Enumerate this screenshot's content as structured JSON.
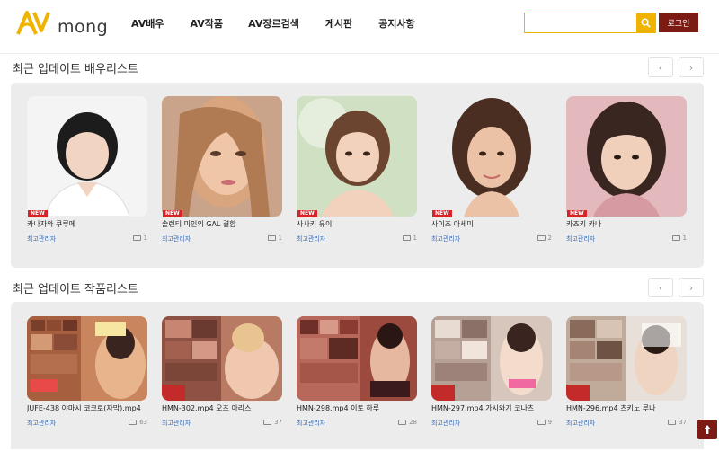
{
  "header": {
    "logo_text": "mong",
    "nav": [
      "AV배우",
      "AV작품",
      "AV장르검색",
      "게시판",
      "공지사항"
    ],
    "search": {
      "value": "",
      "placeholder": ""
    },
    "login_label": "로그인"
  },
  "actors_section": {
    "title": "최근 업데이트 배우리스트",
    "prev": "‹",
    "next": "›",
    "items": [
      {
        "title": "카나자와 쿠루메",
        "author": "최고관리자",
        "count": "1",
        "badge": "NEW"
      },
      {
        "title": "솔렌티 미인의 GAL 결함",
        "author": "최고관리자",
        "count": "1",
        "badge": "NEW"
      },
      {
        "title": "사사키 유이",
        "author": "최고관리자",
        "count": "1",
        "badge": "NEW"
      },
      {
        "title": "사이조 아세미",
        "author": "최고관리자",
        "count": "2",
        "badge": "NEW"
      },
      {
        "title": "카즈키 카나",
        "author": "최고관리자",
        "count": "1",
        "badge": "NEW"
      }
    ]
  },
  "works_section": {
    "title": "최근 업데이트 작품리스트",
    "prev": "‹",
    "next": "›",
    "items": [
      {
        "title": "JUFE-438 야마시 코코로(자막).mp4",
        "author": "최고관리자",
        "count": "63"
      },
      {
        "title": "HMN-302.mp4 오츠 아리스",
        "author": "최고관리자",
        "count": "37"
      },
      {
        "title": "HMN-298.mp4 이토 하루",
        "author": "최고관리자",
        "count": "28"
      },
      {
        "title": "HMN-297.mp4 가시와기 코나츠",
        "author": "최고관리자",
        "count": "9"
      },
      {
        "title": "HMN-296.mp4 츠키노 루나",
        "author": "최고관리자",
        "count": "37"
      }
    ]
  },
  "colors": {
    "accent": "#f0b400",
    "login_bg": "#7c1a14",
    "badge": "#d9232a",
    "panel_bg": "#ececec",
    "author_link": "#3c6fb8"
  },
  "icons": {
    "search": "search-icon",
    "comment": "comment-icon",
    "top": "arrow-up-icon"
  }
}
